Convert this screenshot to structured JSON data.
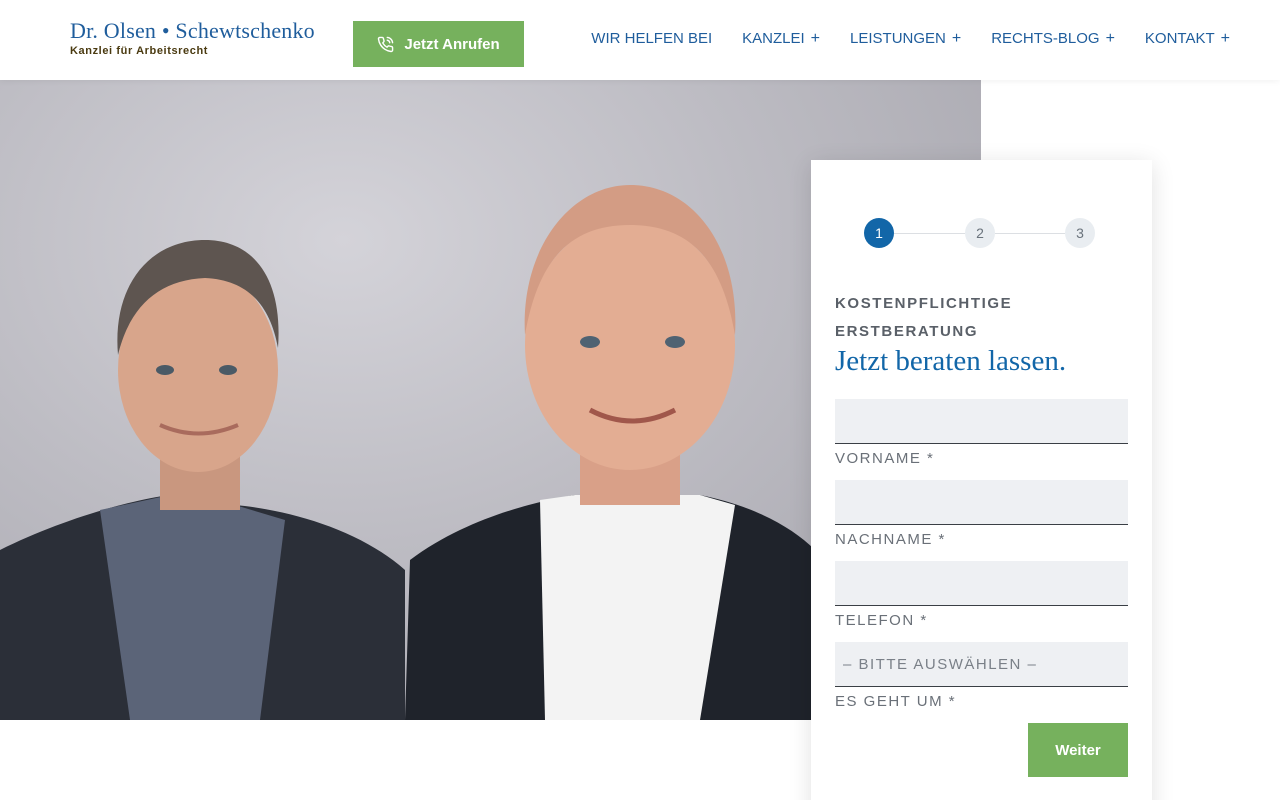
{
  "header": {
    "logo_name": "Dr. Olsen • Schewtschenko",
    "logo_tagline": "Kanzlei für Arbeitsrecht",
    "call_button": {
      "label": "Jetzt Anrufen",
      "icon": "phone-icon"
    },
    "nav": [
      {
        "label": "WIR HELFEN BEI",
        "has_submenu": false
      },
      {
        "label": "KANZLEI",
        "has_submenu": true
      },
      {
        "label": "LEISTUNGEN",
        "has_submenu": true
      },
      {
        "label": "RECHTS-BLOG",
        "has_submenu": true
      },
      {
        "label": "KONTAKT",
        "has_submenu": true
      }
    ],
    "submenu_symbol": "+"
  },
  "form": {
    "steps": [
      "1",
      "2",
      "3"
    ],
    "active_step": 1,
    "eyebrow": "KOSTENPFLICHTIGE ERSTBERATUNG",
    "title": "Jetzt beraten lassen.",
    "fields": [
      {
        "label": "VORNAME *",
        "value": ""
      },
      {
        "label": "NACHNAME *",
        "value": ""
      },
      {
        "label": "TELEFON *",
        "value": ""
      },
      {
        "label": "ES GEHT UM *",
        "value": "– BITTE AUSWÄHLEN –"
      }
    ],
    "submit_label": "Weiter"
  },
  "colors": {
    "brand_blue": "#1f5d9c",
    "accent_blue": "#1266a8",
    "button_green": "#76b15d",
    "tagline_brown": "#4a3a10"
  }
}
